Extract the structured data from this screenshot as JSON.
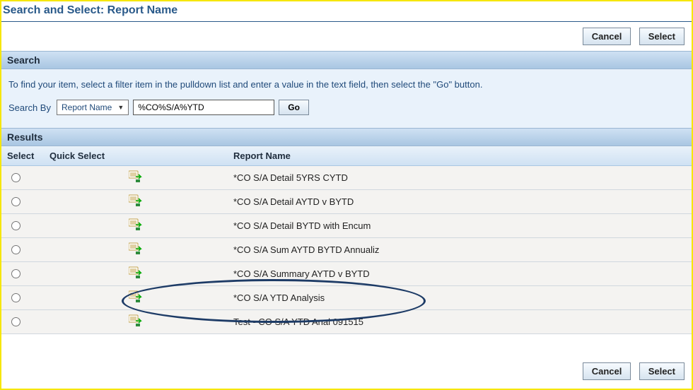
{
  "title": "Search and Select: Report Name",
  "buttons": {
    "cancel": "Cancel",
    "select": "Select",
    "go": "Go"
  },
  "sections": {
    "search": "Search",
    "results": "Results"
  },
  "search": {
    "instructions": "To find your item, select a filter item in the pulldown list and enter a value in the text field, then select the \"Go\" button.",
    "by_label": "Search By",
    "filter_selected": "Report Name",
    "value": "%CO%S/A%YTD"
  },
  "columns": {
    "select": "Select",
    "quick": "Quick Select",
    "name": "Report Name"
  },
  "rows": [
    {
      "name": "*CO S/A Detail 5YRS CYTD"
    },
    {
      "name": "*CO S/A Detail AYTD v BYTD"
    },
    {
      "name": "*CO S/A Detail BYTD with Encum"
    },
    {
      "name": "*CO S/A Sum AYTD BYTD Annualiz"
    },
    {
      "name": "*CO S/A Summary AYTD v BYTD"
    },
    {
      "name": "*CO S/A YTD Analysis"
    },
    {
      "name": "Test - CO S/A YTD Anal 091515"
    }
  ]
}
